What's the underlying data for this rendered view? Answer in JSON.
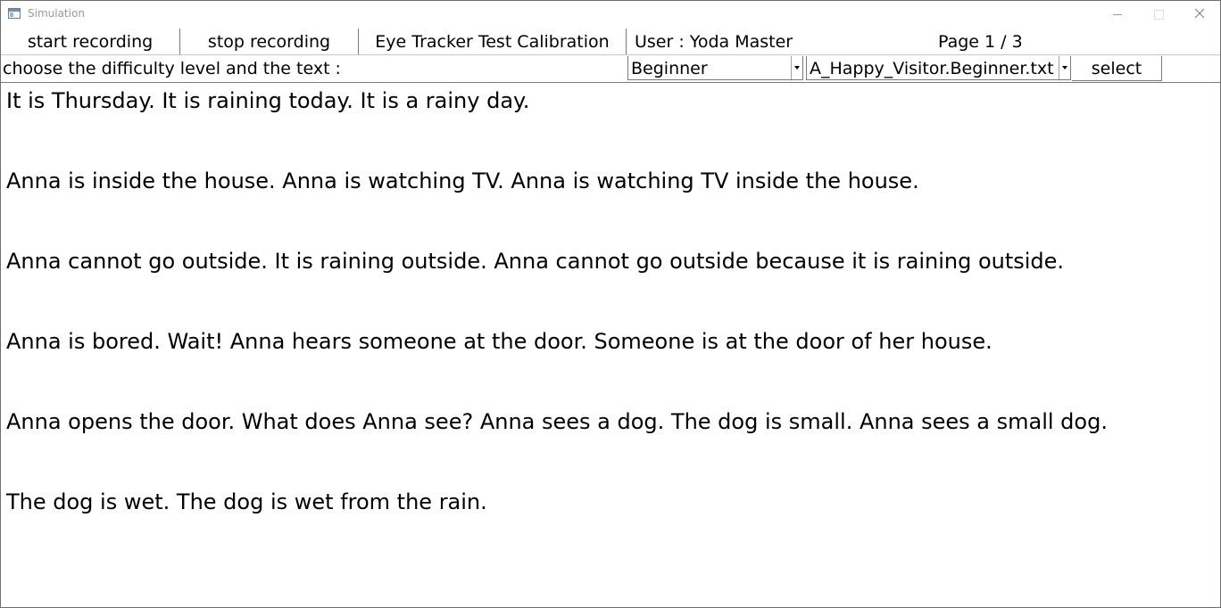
{
  "window": {
    "title": "Simulation",
    "icons": {
      "app": "window-icon",
      "minimize": "minimize-icon",
      "maximize": "maximize-icon",
      "close": "close-icon"
    }
  },
  "toolbar": {
    "start_label": "start recording",
    "stop_label": "stop recording",
    "calibration_label": "Eye Tracker Test Calibration",
    "user_label": "User : Yoda Master",
    "page_label": "Page 1 / 3"
  },
  "selection": {
    "prompt": "choose the difficulty level and the text :",
    "difficulty_value": "Beginner",
    "text_value": "A_Happy_Visitor.Beginner.txt",
    "select_label": "select"
  },
  "content": {
    "paragraphs": [
      "It is Thursday. It is raining today. It is a rainy day.",
      "Anna is inside the house. Anna is watching TV. Anna is watching TV inside the house.",
      "Anna cannot go outside. It is raining outside. Anna cannot go outside because it is raining outside.",
      "Anna is bored. Wait! Anna hears someone at the door. Someone is at the door of her house.",
      "Anna opens the door. What does Anna see? Anna sees a dog. The dog is small. Anna sees a small dog.",
      "The dog is wet. The dog is wet from the rain."
    ]
  }
}
